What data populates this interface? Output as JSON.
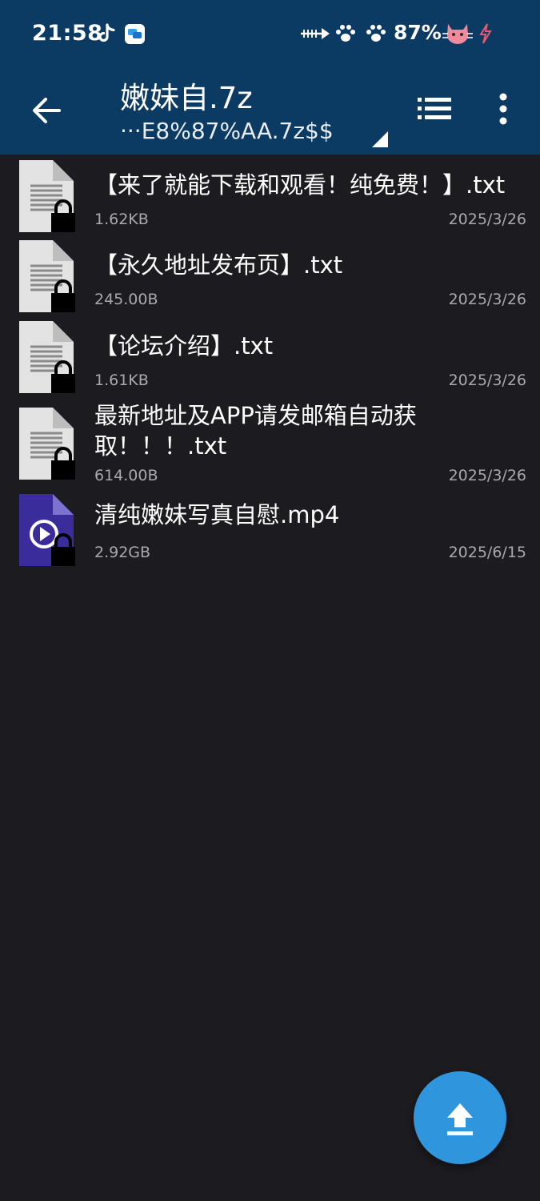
{
  "status_bar": {
    "time": "21:58",
    "battery": "87%",
    "icons": [
      "tiktok-icon",
      "chat-app-icon",
      "fish-icon",
      "paw-icon",
      "paw-icon",
      "cat-icon",
      "charging-icon"
    ]
  },
  "header": {
    "title": "嫩妹自.7z",
    "subtitle": "···E8%87%AA.7z$$",
    "accent_color": "#0b3a63"
  },
  "files": [
    {
      "name": "【来了就能下载和观看！纯免费！】.txt",
      "size": "1.62KB",
      "date": "2025/3/26",
      "type": "text-file-icon"
    },
    {
      "name": "【永久地址发布页】.txt",
      "size": "245.00B",
      "date": "2025/3/26",
      "type": "text-file-icon"
    },
    {
      "name": "【论坛介绍】.txt",
      "size": "1.61KB",
      "date": "2025/3/26",
      "type": "text-file-icon"
    },
    {
      "name": "最新地址及APP请发邮箱自动获取！！！.txt",
      "size": "614.00B",
      "date": "2025/3/26",
      "type": "text-file-icon"
    },
    {
      "name": "清纯嫩妹写真自慰.mp4",
      "size": "2.92GB",
      "date": "2025/6/15",
      "type": "video-file-icon"
    }
  ],
  "fab": {
    "icon": "upload-icon",
    "color": "#2f95dd"
  }
}
